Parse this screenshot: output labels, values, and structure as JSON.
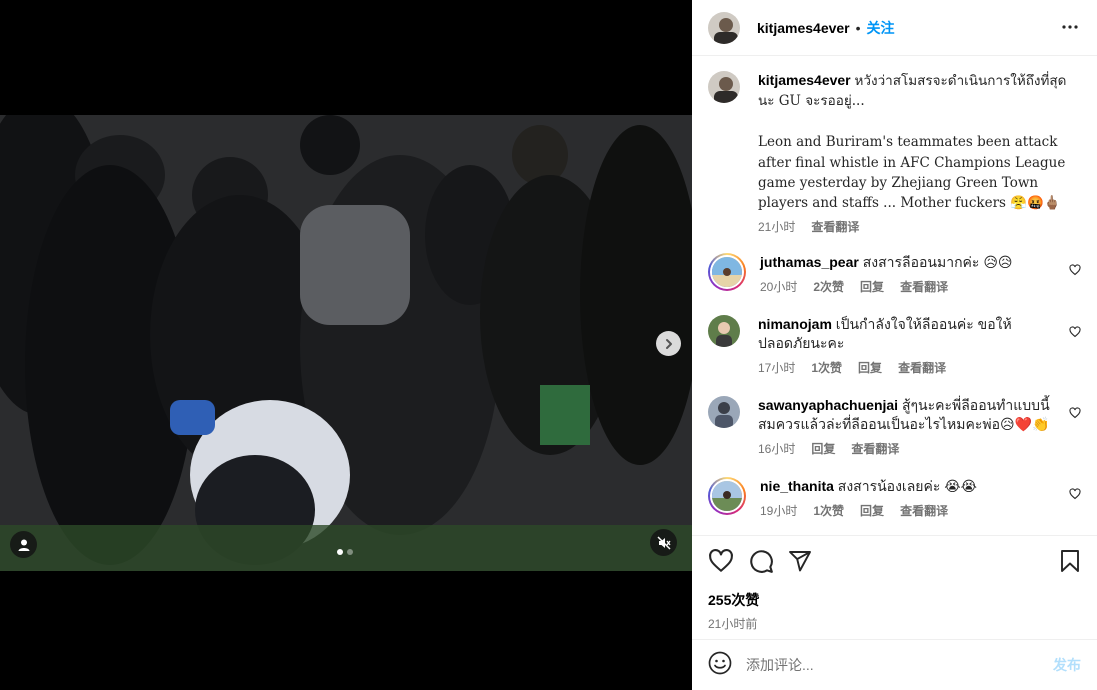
{
  "post": {
    "username": "kitjames4ever",
    "separator": "•",
    "follow_label": "关注",
    "more_icon": "more-horizontal-icon"
  },
  "media": {
    "slide_count": 2,
    "active_slide": 1,
    "icons": [
      "chevron-right-icon",
      "user-tag-icon",
      "muted-speaker-icon"
    ]
  },
  "caption": {
    "username": "kitjames4ever",
    "text": "หวังว่าสโมสรจะดำเนินการให้ถึงที่สุดนะ GU จะรออยู่...\n\nLeon and Buriram's teammates been attack after final whistle in AFC Champions League game yesterday by Zhejiang Green Town players and staffs ... Mother fuckers 😤🤬🖕🏽",
    "time": "21小时",
    "translate": "查看翻译"
  },
  "comments": [
    {
      "username": "juthamas_pear",
      "text": "สงสารลีออนมากค่ะ 😥😥",
      "time": "20小时",
      "likes": "2次赞",
      "reply": "回复",
      "translate": "查看翻译",
      "story": true
    },
    {
      "username": "nimanojam",
      "text": "เป็นกำลังใจให้ลีออนค่ะ ขอให้ปลอดภัยนะคะ",
      "time": "17小时",
      "likes": "1次赞",
      "reply": "回复",
      "translate": "查看翻译",
      "story": false
    },
    {
      "username": "sawanyaphachuenjai",
      "text": "สู้ๆนะคะพี่ลีออนทำแบบนี้สมควรแล้วล่ะที่ลีออนเป็นอะไรไหมคะพ่อ😥❤️👏",
      "time": "16小时",
      "reply": "回复",
      "translate": "查看翻译",
      "story": false
    },
    {
      "username": "nie_thanita",
      "text": "สงสารน้องเลยค่ะ 😭😭",
      "time": "19小时",
      "likes": "1次赞",
      "reply": "回复",
      "translate": "查看翻译",
      "story": true
    }
  ],
  "actions": {
    "icons": [
      "heart-icon",
      "comment-icon",
      "share-icon",
      "bookmark-icon"
    ],
    "likes_text": "255次赞",
    "time_text": "21小时前"
  },
  "add_comment": {
    "placeholder": "添加评论...",
    "post_label": "发布",
    "emoji_icon": "emoji-icon"
  },
  "colors": {
    "accent": "#0095f6",
    "post_disabled": "#b2dffc",
    "muted_text": "#737373"
  }
}
